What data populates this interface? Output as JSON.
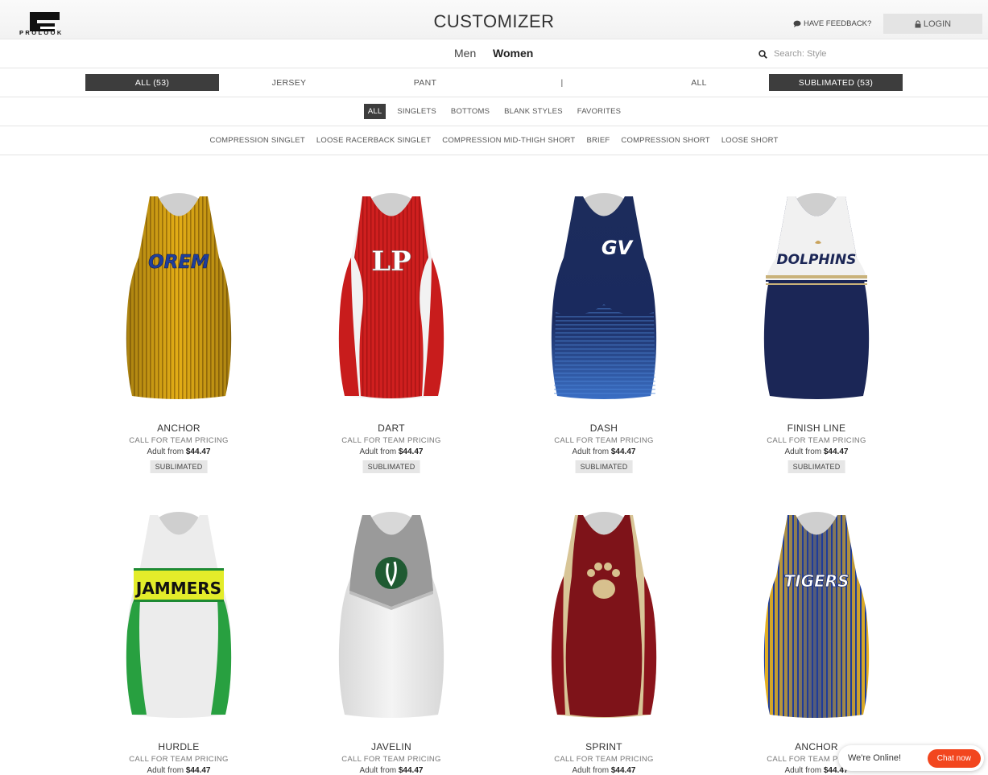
{
  "header": {
    "logo_text": "PROLOOK",
    "title": "CUSTOMIZER",
    "feedback_label": "HAVE FEEDBACK?",
    "login_label": "LOGIN"
  },
  "gender_tabs": {
    "men": "Men",
    "women": "Women",
    "active": "Women"
  },
  "search": {
    "placeholder": "Search: Style",
    "value": ""
  },
  "filters": {
    "all": "ALL (53)",
    "jersey": "JERSEY",
    "pant": "PANT",
    "divider": "|",
    "all_type": "ALL",
    "sublimated": "SUBLIMATED (53)"
  },
  "categories": [
    "ALL",
    "SINGLETS",
    "BOTTOMS",
    "BLANK STYLES",
    "FAVORITES"
  ],
  "subcategories": [
    "COMPRESSION SINGLET",
    "LOOSE RACERBACK SINGLET",
    "COMPRESSION MID-THIGH SHORT",
    "BRIEF",
    "COMPRESSION SHORT",
    "LOOSE SHORT"
  ],
  "products": [
    {
      "name": "ANCHOR",
      "call": "CALL FOR TEAM PRICING",
      "price_prefix": "Adult from",
      "price": "$44.47",
      "badge": "SUBLIMATED",
      "logo_text": "OREM"
    },
    {
      "name": "DART",
      "call": "CALL FOR TEAM PRICING",
      "price_prefix": "Adult from",
      "price": "$44.47",
      "badge": "SUBLIMATED",
      "logo_text": "LP"
    },
    {
      "name": "DASH",
      "call": "CALL FOR TEAM PRICING",
      "price_prefix": "Adult from",
      "price": "$44.47",
      "badge": "SUBLIMATED",
      "logo_text": "GV"
    },
    {
      "name": "FINISH LINE",
      "call": "CALL FOR TEAM PRICING",
      "price_prefix": "Adult from",
      "price": "$44.47",
      "badge": "SUBLIMATED",
      "logo_text": "DOLPHINS"
    },
    {
      "name": "HURDLE",
      "call": "CALL FOR TEAM PRICING",
      "price_prefix": "Adult from",
      "price": "$44.47",
      "logo_text": "JAMMERS"
    },
    {
      "name": "JAVELIN",
      "call": "CALL FOR TEAM PRICING",
      "price_prefix": "Adult from",
      "price": "$44.47"
    },
    {
      "name": "SPRINT",
      "call": "CALL FOR TEAM PRICING",
      "price_prefix": "Adult from",
      "price": "$44.47"
    },
    {
      "name": "ANCHOR",
      "call": "CALL FOR TEAM PRICING",
      "price_prefix": "Adult from",
      "price": "$44.47",
      "logo_text": "TIGERS"
    }
  ],
  "chat": {
    "status": "We're Online!",
    "button": "Chat now"
  },
  "colors": {
    "active_filter": "#3d3d3d",
    "chat_button": "#f2461e"
  }
}
